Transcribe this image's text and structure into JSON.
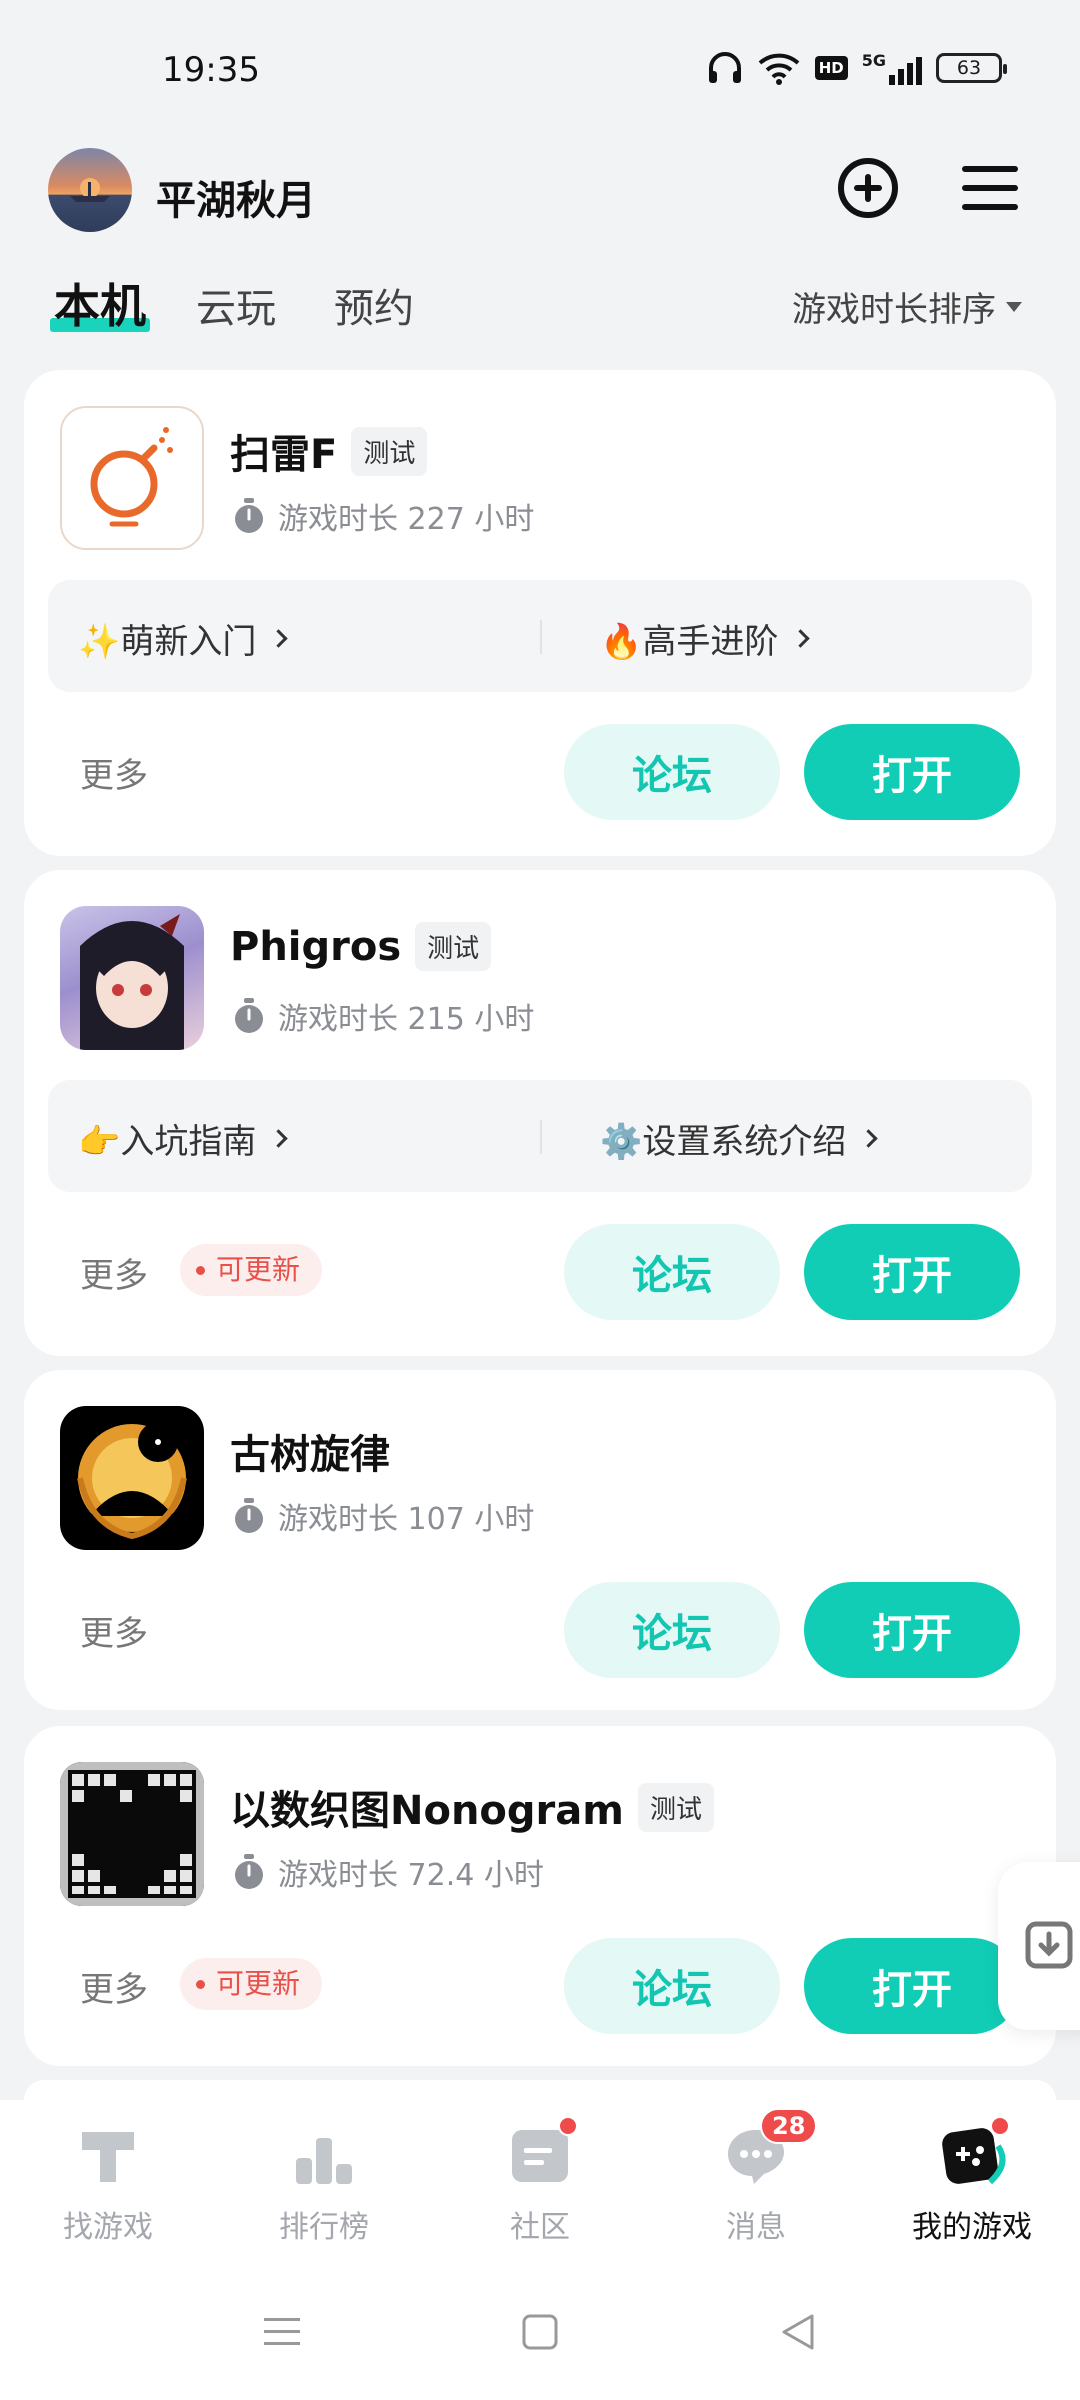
{
  "status_bar": {
    "time": "19:35",
    "battery": "63",
    "network": "5G",
    "hd": "HD"
  },
  "header": {
    "username": "平湖秋月"
  },
  "tabs": [
    {
      "label": "本机",
      "active": true
    },
    {
      "label": "云玩",
      "active": false
    },
    {
      "label": "预约",
      "active": false
    }
  ],
  "sort": {
    "label": "游戏时长排序"
  },
  "games": [
    {
      "name": "扫雷F",
      "tag": "测试",
      "playtime": "游戏时长 227 小时",
      "guides": [
        {
          "label": "✨萌新入门"
        },
        {
          "label": "🔥高手进阶"
        }
      ],
      "more": "更多",
      "forum": "论坛",
      "open": "打开"
    },
    {
      "name": "Phigros",
      "tag": "测试",
      "playtime": "游戏时长 215 小时",
      "guides": [
        {
          "label": "👉入坑指南"
        },
        {
          "label": "⚙️设置系统介绍"
        }
      ],
      "more": "更多",
      "update": "可更新",
      "forum": "论坛",
      "open": "打开"
    },
    {
      "name": "古树旋律",
      "playtime": "游戏时长 107 小时",
      "more": "更多",
      "forum": "论坛",
      "open": "打开"
    },
    {
      "name": "以数织图Nonogram",
      "tag": "测试",
      "playtime": "游戏时长 72.4 小时",
      "more": "更多",
      "update": "可更新",
      "forum": "论坛",
      "open": "打开"
    }
  ],
  "bottom_nav": [
    {
      "label": "找游戏",
      "icon": "find-game-icon"
    },
    {
      "label": "排行榜",
      "icon": "ranking-icon"
    },
    {
      "label": "社区",
      "icon": "community-icon"
    },
    {
      "label": "消息",
      "icon": "message-icon",
      "badge": "28"
    },
    {
      "label": "我的游戏",
      "icon": "my-games-icon",
      "active": true
    }
  ],
  "colors": {
    "accent": "#11cdb5",
    "accent_light": "#e4f8f6",
    "badge_red": "#f04b4b"
  }
}
